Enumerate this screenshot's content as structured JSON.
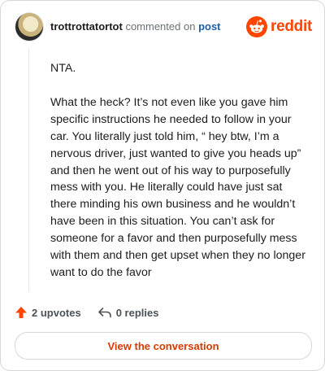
{
  "comment": {
    "username": "trottrottatortot",
    "action_text": "commented on",
    "post_link": "post",
    "paragraphs": [
      "NTA.",
      "What the heck? It’s not even like you gave him specific instructions he needed to follow in your car. You literally just told him, “ hey btw, I’m a nervous driver, just wanted to give you heads up” and then he went out of his way to purposefully mess with you. He literally could have just sat there minding his own business and he wouldn’t have been in this situation. You can’t ask for someone for a favor and then purposefully mess with them and then get upset when they no longer want to do the favor"
    ]
  },
  "brand": {
    "wordmark": "reddit",
    "color": "#ff4500"
  },
  "actions": {
    "upvotes": "2 upvotes",
    "replies": "0 replies"
  },
  "cta": {
    "label": "View the conversation",
    "color": "#d93a00"
  },
  "icons": {
    "avatar": "user-avatar",
    "reddit_logo": "reddit-alien-icon",
    "upvote": "upvote-arrow-icon",
    "reply": "reply-arrow-icon"
  }
}
